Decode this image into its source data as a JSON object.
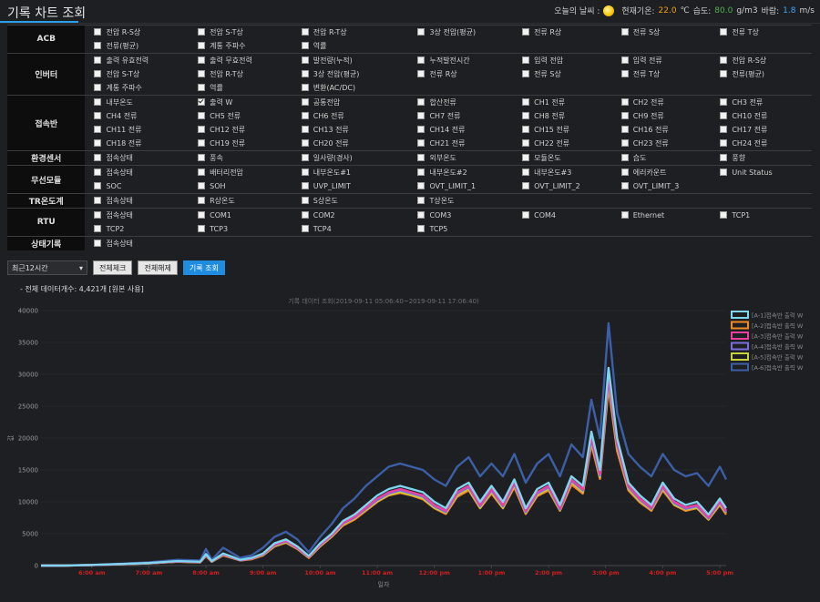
{
  "header": {
    "title": "기록 차트 조회",
    "weather_label": "오늘의 날씨 :",
    "weather_icon": "sun-icon",
    "temp_label": "현재기온:",
    "temp_value": "22.0",
    "temp_unit": "℃",
    "humidity_label": "습도:",
    "humidity_value": "80.0",
    "humidity_unit": "g/m3",
    "wind_label": "바람:",
    "wind_value": "1.8",
    "wind_unit": "m/s"
  },
  "groups": [
    {
      "label": "ACB",
      "rows": [
        [
          {
            "label": "전압 R-S상",
            "checked": false
          },
          {
            "label": "전압 S-T상",
            "checked": false
          },
          {
            "label": "전압 R-T상",
            "checked": false
          },
          {
            "label": "3상 전압(평균)",
            "checked": false
          },
          {
            "label": "전류 R상",
            "checked": false
          },
          {
            "label": "전류 S상",
            "checked": false
          },
          {
            "label": "전류 T상",
            "checked": false
          }
        ],
        [
          {
            "label": "전류(평균)",
            "checked": false
          },
          {
            "label": "계통 주파수",
            "checked": false
          },
          {
            "label": "역률",
            "checked": false
          }
        ]
      ]
    },
    {
      "label": "인버터",
      "rows": [
        [
          {
            "label": "출력 유효전력",
            "checked": false
          },
          {
            "label": "출력 무효전력",
            "checked": false
          },
          {
            "label": "발전량(누적)",
            "checked": false
          },
          {
            "label": "누적발전시간",
            "checked": false
          },
          {
            "label": "입력 전압",
            "checked": false
          },
          {
            "label": "입력 전류",
            "checked": false
          },
          {
            "label": "전압 R-S상",
            "checked": false
          }
        ],
        [
          {
            "label": "전압 S-T상",
            "checked": false
          },
          {
            "label": "전압 R-T상",
            "checked": false
          },
          {
            "label": "3상 전압(평균)",
            "checked": false
          },
          {
            "label": "전류 R상",
            "checked": false
          },
          {
            "label": "전류 S상",
            "checked": false
          },
          {
            "label": "전류 T상",
            "checked": false
          },
          {
            "label": "전류(평균)",
            "checked": false
          }
        ],
        [
          {
            "label": "계통 주파수",
            "checked": false
          },
          {
            "label": "역률",
            "checked": false
          },
          {
            "label": "변환(AC/DC)",
            "checked": false
          }
        ]
      ]
    },
    {
      "label": "접속반",
      "rows": [
        [
          {
            "label": "내부온도",
            "checked": false
          },
          {
            "label": "출력 W",
            "checked": true
          },
          {
            "label": "공통전압",
            "checked": false
          },
          {
            "label": "합산전류",
            "checked": false
          },
          {
            "label": "CH1 전류",
            "checked": false
          },
          {
            "label": "CH2 전류",
            "checked": false
          },
          {
            "label": "CH3 전류",
            "checked": false
          }
        ],
        [
          {
            "label": "CH4 전류",
            "checked": false
          },
          {
            "label": "CH5 전류",
            "checked": false
          },
          {
            "label": "CH6 전류",
            "checked": false
          },
          {
            "label": "CH7 전류",
            "checked": false
          },
          {
            "label": "CH8 전류",
            "checked": false
          },
          {
            "label": "CH9 전류",
            "checked": false
          },
          {
            "label": "CH10 전류",
            "checked": false
          }
        ],
        [
          {
            "label": "CH11 전류",
            "checked": false
          },
          {
            "label": "CH12 전류",
            "checked": false
          },
          {
            "label": "CH13 전류",
            "checked": false
          },
          {
            "label": "CH14 전류",
            "checked": false
          },
          {
            "label": "CH15 전류",
            "checked": false
          },
          {
            "label": "CH16 전류",
            "checked": false
          },
          {
            "label": "CH17 전류",
            "checked": false
          }
        ],
        [
          {
            "label": "CH18 전류",
            "checked": false
          },
          {
            "label": "CH19 전류",
            "checked": false
          },
          {
            "label": "CH20 전류",
            "checked": false
          },
          {
            "label": "CH21 전류",
            "checked": false
          },
          {
            "label": "CH22 전류",
            "checked": false
          },
          {
            "label": "CH23 전류",
            "checked": false
          },
          {
            "label": "CH24 전류",
            "checked": false
          }
        ]
      ]
    },
    {
      "label": "환경센서",
      "rows": [
        [
          {
            "label": "접속상태",
            "checked": false
          },
          {
            "label": "풍속",
            "checked": false
          },
          {
            "label": "일사량(경사)",
            "checked": false
          },
          {
            "label": "외부온도",
            "checked": false
          },
          {
            "label": "모듈온도",
            "checked": false
          },
          {
            "label": "습도",
            "checked": false
          },
          {
            "label": "풍향",
            "checked": false
          }
        ]
      ]
    },
    {
      "label": "무선모듈",
      "rows": [
        [
          {
            "label": "접속상태",
            "checked": false
          },
          {
            "label": "배터리전압",
            "checked": false
          },
          {
            "label": "내부온도#1",
            "checked": false
          },
          {
            "label": "내부온도#2",
            "checked": false
          },
          {
            "label": "내부온도#3",
            "checked": false
          },
          {
            "label": "에러카운트",
            "checked": false
          },
          {
            "label": "Unit Status",
            "checked": false
          }
        ],
        [
          {
            "label": "SOC",
            "checked": false
          },
          {
            "label": "SOH",
            "checked": false
          },
          {
            "label": "UVP_LIMIT",
            "checked": false
          },
          {
            "label": "OVT_LIMIT_1",
            "checked": false
          },
          {
            "label": "OVT_LIMIT_2",
            "checked": false
          },
          {
            "label": "OVT_LIMIT_3",
            "checked": false
          }
        ]
      ]
    },
    {
      "label": "TR온도계",
      "rows": [
        [
          {
            "label": "접속상태",
            "checked": false
          },
          {
            "label": "R상온도",
            "checked": false
          },
          {
            "label": "S상온도",
            "checked": false
          },
          {
            "label": "T상온도",
            "checked": false
          }
        ]
      ]
    },
    {
      "label": "RTU",
      "rows": [
        [
          {
            "label": "접속상태",
            "checked": false
          },
          {
            "label": "COM1",
            "checked": false
          },
          {
            "label": "COM2",
            "checked": false
          },
          {
            "label": "COM3",
            "checked": false
          },
          {
            "label": "COM4",
            "checked": false
          },
          {
            "label": "Ethernet",
            "checked": false
          },
          {
            "label": "TCP1",
            "checked": false
          }
        ],
        [
          {
            "label": "TCP2",
            "checked": false
          },
          {
            "label": "TCP3",
            "checked": false
          },
          {
            "label": "TCP4",
            "checked": false
          },
          {
            "label": "TCP5",
            "checked": false
          }
        ]
      ]
    },
    {
      "label": "상태기록",
      "rows": [
        [
          {
            "label": "접속상태",
            "checked": false
          }
        ]
      ]
    }
  ],
  "controls": {
    "range_value": "최근12시간",
    "select_all_label": "전체체크",
    "clear_all_label": "전체해제",
    "search_label": "기록 조회"
  },
  "data_count_text": "- 전체 데이터개수: 4,421개 [원본 사용]",
  "chart_data": {
    "type": "line",
    "title": "기록 데이터 조회(2019-09-11 05:06:40~2019-09-11 17:06:40)",
    "xlabel": "일자",
    "ylabel": "값",
    "ylim": [
      0,
      40000
    ],
    "yticks": [
      0,
      5000,
      10000,
      15000,
      20000,
      25000,
      30000,
      35000,
      40000
    ],
    "xticks": [
      "6:00 am",
      "7:00 am",
      "8:00 am",
      "9:00 am",
      "10:00 am",
      "11:00 am",
      "12:00 pm",
      "1:00 pm",
      "2:00 pm",
      "3:00 pm",
      "4:00 pm",
      "5:00 pm"
    ],
    "x_hours": [
      5.11,
      5.5,
      6.0,
      6.5,
      7.0,
      7.5,
      7.9,
      8.0,
      8.1,
      8.3,
      8.6,
      8.8,
      9.0,
      9.2,
      9.4,
      9.6,
      9.8,
      10.0,
      10.2,
      10.4,
      10.6,
      10.8,
      11.0,
      11.2,
      11.4,
      11.6,
      11.8,
      12.0,
      12.2,
      12.4,
      12.6,
      12.8,
      13.0,
      13.2,
      13.4,
      13.6,
      13.8,
      14.0,
      14.2,
      14.4,
      14.6,
      14.75,
      14.9,
      15.05,
      15.2,
      15.4,
      15.6,
      15.8,
      16.0,
      16.2,
      16.4,
      16.6,
      16.8,
      17.0,
      17.11
    ],
    "series": [
      {
        "name": "[A-1]접속반 출력 W",
        "color": "#7ed6ef",
        "values": [
          0,
          0,
          100,
          250,
          400,
          700,
          600,
          1800,
          700,
          1900,
          900,
          1200,
          1900,
          3500,
          4100,
          3000,
          1500,
          3500,
          5000,
          7000,
          8000,
          9500,
          11000,
          12000,
          12500,
          12000,
          11500,
          10000,
          9000,
          12000,
          13000,
          10000,
          12500,
          10000,
          13500,
          9000,
          12000,
          13000,
          9500,
          14000,
          12500,
          21000,
          15000,
          31000,
          20000,
          13000,
          11000,
          9500,
          13000,
          10500,
          9500,
          10000,
          8000,
          10500,
          9000
        ]
      },
      {
        "name": "[A-2]접속반 출력 W",
        "color": "#f08a24",
        "values": [
          0,
          0,
          80,
          200,
          350,
          600,
          500,
          1500,
          600,
          1600,
          800,
          1000,
          1600,
          3000,
          3600,
          2600,
          1200,
          3000,
          4500,
          6300,
          7200,
          8600,
          10000,
          11000,
          11400,
          11000,
          10400,
          9000,
          8100,
          10800,
          11800,
          9000,
          11300,
          9000,
          12300,
          8100,
          10900,
          11800,
          8600,
          12700,
          11300,
          19000,
          13600,
          28000,
          18000,
          11800,
          9900,
          8600,
          11800,
          9500,
          8600,
          9000,
          7200,
          9500,
          8000
        ]
      },
      {
        "name": "[A-3]접속반 출력 W",
        "color": "#ec3fa0",
        "values": [
          0,
          0,
          90,
          230,
          380,
          650,
          560,
          1700,
          650,
          1800,
          850,
          1100,
          1800,
          3300,
          3900,
          2800,
          1400,
          3300,
          4800,
          6700,
          7600,
          9100,
          10500,
          11500,
          12000,
          11500,
          11000,
          9500,
          8600,
          11500,
          12500,
          9500,
          12000,
          9500,
          13000,
          8600,
          11500,
          12500,
          9000,
          13500,
          12000,
          20200,
          14400,
          29800,
          19200,
          12500,
          10500,
          9100,
          12500,
          10000,
          9100,
          9500,
          7600,
          10100,
          8600
        ]
      },
      {
        "name": "[A-4]접속반 출력 W",
        "color": "#7a6ee0",
        "values": [
          0,
          0,
          90,
          220,
          370,
          640,
          540,
          1650,
          640,
          1750,
          830,
          1080,
          1750,
          3200,
          3800,
          2750,
          1350,
          3200,
          4700,
          6600,
          7500,
          8900,
          10300,
          11300,
          11800,
          11300,
          10800,
          9300,
          8400,
          11300,
          12300,
          9300,
          11800,
          9300,
          12800,
          8400,
          11300,
          12300,
          8800,
          13300,
          11800,
          19800,
          14100,
          29300,
          18900,
          12300,
          10300,
          8900,
          12300,
          9800,
          8900,
          9300,
          7400,
          9900,
          8400
        ]
      },
      {
        "name": "[A-5]접속반 출력 W",
        "color": "#c7d23a",
        "values": [
          0,
          0,
          85,
          210,
          360,
          620,
          520,
          1600,
          620,
          1700,
          810,
          1050,
          1700,
          3100,
          3700,
          2700,
          1300,
          3100,
          4600,
          6500,
          7400,
          8800,
          10100,
          11100,
          11600,
          11100,
          10600,
          9100,
          8300,
          11100,
          12100,
          9100,
          11600,
          9100,
          12600,
          8300,
          11100,
          12100,
          8700,
          13100,
          11600,
          19500,
          13900,
          28800,
          18600,
          12100,
          10100,
          8800,
          12100,
          9600,
          8800,
          9100,
          7300,
          9700,
          8300
        ]
      },
      {
        "name": "[A-6]접속반 출력 W",
        "color": "#3c5fa8",
        "values": [
          0,
          0,
          120,
          300,
          500,
          900,
          800,
          2600,
          900,
          2800,
          1200,
          1600,
          2800,
          4500,
          5300,
          4100,
          2100,
          4500,
          6500,
          9000,
          10500,
          12500,
          14000,
          15500,
          16000,
          15500,
          15000,
          13500,
          12500,
          15500,
          17000,
          14000,
          16000,
          14000,
          17500,
          13000,
          16000,
          17500,
          14000,
          19000,
          17000,
          26000,
          20000,
          38000,
          24000,
          17500,
          15500,
          14000,
          17500,
          15000,
          14000,
          14500,
          12500,
          15500,
          13500
        ]
      }
    ]
  }
}
